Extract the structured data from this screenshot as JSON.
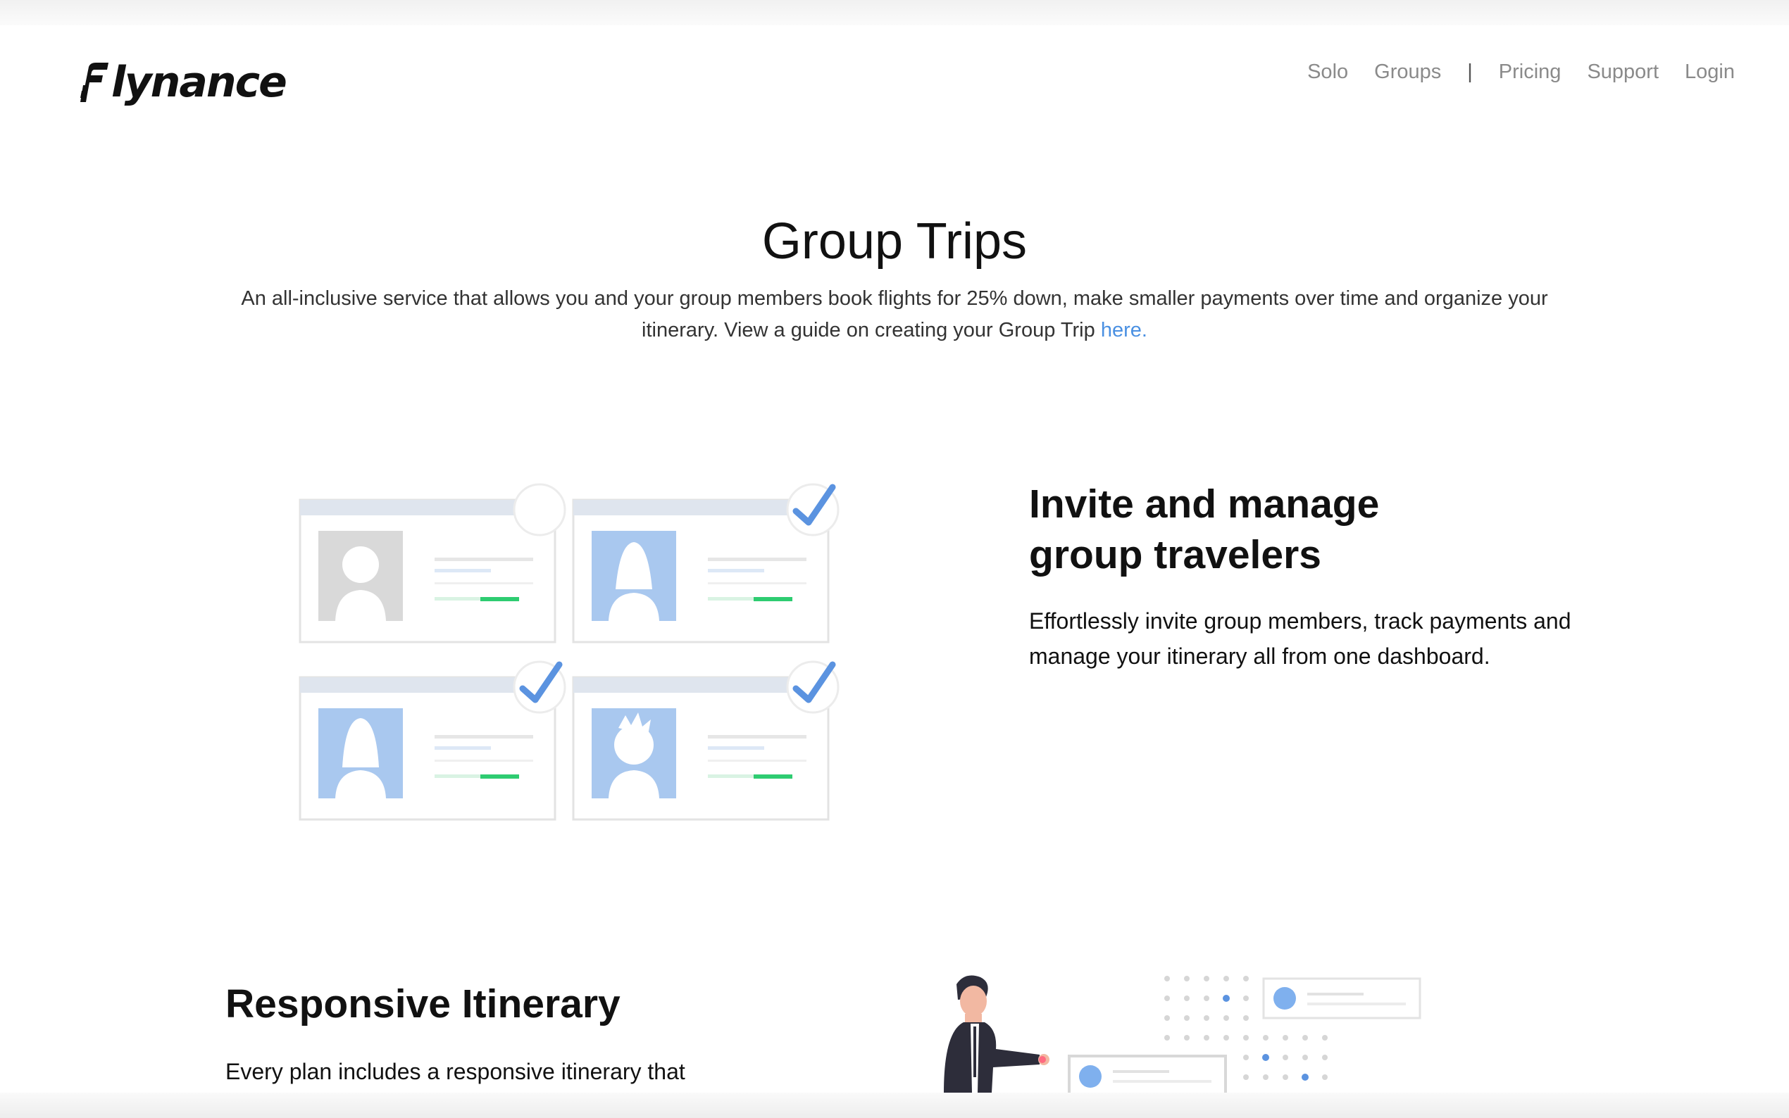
{
  "header": {
    "logo_text": "lynance",
    "nav": {
      "solo": "Solo",
      "groups": "Groups",
      "divider": "|",
      "pricing": "Pricing",
      "support": "Support",
      "login": "Login"
    }
  },
  "hero": {
    "title": "Group Trips",
    "description": "An all-inclusive service that allows you and your group members book flights for 25% down, make smaller payments over time and organize your itinerary. View a guide on creating your Group Trip",
    "link_text": "here."
  },
  "feature_invite": {
    "title_line1": "Invite and manage",
    "title_line2": "group travelers",
    "description": "Effortlessly invite group members, track payments and manage your itinerary all from one dashboard."
  },
  "feature_itinerary": {
    "title": "Responsive Itinerary",
    "description": "Every plan includes a responsive itinerary that"
  },
  "colors": {
    "link": "#4a90e2",
    "accent_blue": "#a9c8ef",
    "check_blue": "#5b93e0",
    "green": "#2ecc71",
    "nav_gray": "#8a8a8a"
  }
}
